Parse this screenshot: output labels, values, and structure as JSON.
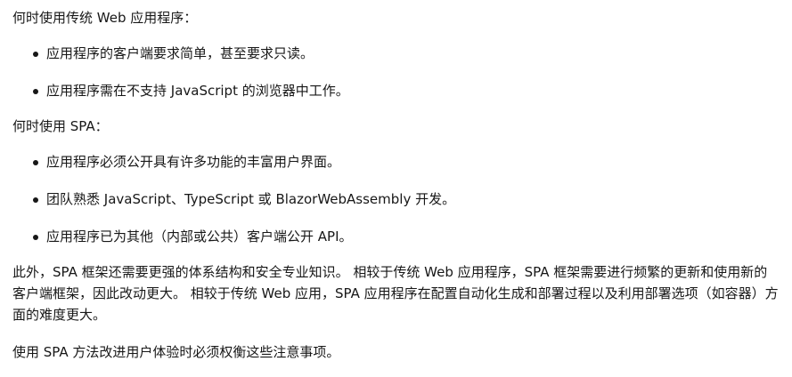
{
  "sections": {
    "web_apps_heading": "何时使用传统 Web 应用程序：",
    "web_apps_items": [
      "应用程序的客户端要求简单，甚至要求只读。",
      "应用程序需在不支持 JavaScript 的浏览器中工作。"
    ],
    "spa_heading": "何时使用 SPA：",
    "spa_items": [
      "应用程序必须公开具有许多功能的丰富用户界面。",
      "团队熟悉 JavaScript、TypeScript 或 BlazorWebAssembly 开发。",
      "应用程序已为其他（内部或公共）客户端公开 API。"
    ],
    "tradeoff_paragraph": "此外，SPA 框架还需要更强的体系结构和安全专业知识。 相较于传统 Web 应用程序，SPA 框架需要进行频繁的更新和使用新的客户端框架，因此改动更大。 相较于传统 Web 应用，SPA 应用程序在配置自动化生成和部署过程以及利用部署选项（如容器）方面的难度更大。",
    "conclusion_paragraph": "使用 SPA 方法改进用户体验时必须权衡这些注意事项。"
  }
}
